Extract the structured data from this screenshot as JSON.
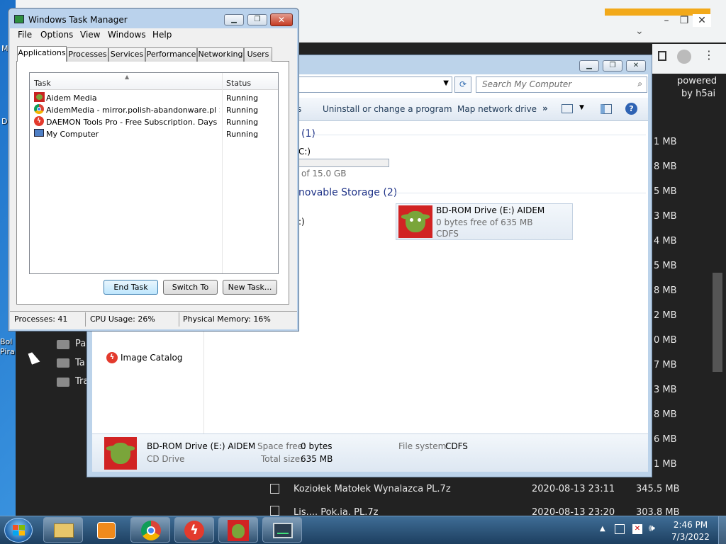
{
  "desktop": {
    "shortcut_a": "M",
    "shortcut_b": "D",
    "shortcut_c": "Bol",
    "shortcut_d": "Pira"
  },
  "chrome": {
    "powered": "powered",
    "by": "by h5ai",
    "folders": [
      "Pa",
      "Ta",
      "Tra"
    ],
    "sizes": [
      "1 MB",
      "8 MB",
      "5 MB",
      "3 MB",
      "4 MB",
      "5 MB",
      "8 MB",
      "2 MB",
      "0 MB",
      "7 MB",
      "3 MB",
      "8 MB",
      "6 MB",
      "1 MB"
    ],
    "file_name": "Koziołek Matołek Wynalazca PL.7z",
    "file_date": "2020-08-13 23:11",
    "file_size": "345.5 MB",
    "cut_file_name": "Lis.... Pok.ia. PL.7z",
    "cut_file_date": "2020-08-13 23:20",
    "cut_file_size": "303.8 MB"
  },
  "explorer": {
    "search_placeholder": "Search My Computer",
    "cmd_partial": "s",
    "cmd_uninstall": "Uninstall or change a program",
    "cmd_map": "Map network drive",
    "cmd_more": "»",
    "hdd_count": "(1)",
    "hdd_label": "C:)",
    "hdd_free": "of 15.0 GB",
    "removable_header": "novable Storage (2)",
    "floppy_label": ":)",
    "drive_name": "BD-ROM Drive (E:) AIDEM",
    "drive_free": "0 bytes free of 635 MB",
    "drive_fs": "CDFS",
    "nav_image_catalog": "Image Catalog",
    "details": {
      "name": "BD-ROM Drive (E:) AIDEM",
      "type": "CD Drive",
      "space_free_label": "Space free:",
      "space_free": "0 bytes",
      "total_size_label": "Total size:",
      "total_size": "635 MB",
      "fs_label": "File system:",
      "fs": "CDFS"
    }
  },
  "taskmanager": {
    "title": "Windows Task Manager",
    "menu": [
      "File",
      "Options",
      "View",
      "Windows",
      "Help"
    ],
    "tabs": [
      "Applications",
      "Processes",
      "Services",
      "Performance",
      "Networking",
      "Users"
    ],
    "col_task": "Task",
    "col_status": "Status",
    "rows": [
      {
        "task": "Aidem Media",
        "status": "Running",
        "icon": "aidem-icon"
      },
      {
        "task": "AidemMedia - mirror.polish-abandonware.pl > Gr...",
        "status": "Running",
        "icon": "chrome-icon"
      },
      {
        "task": "DAEMON Tools Pro - Free Subscription. Days left...",
        "status": "Running",
        "icon": "daemon-tools-icon"
      },
      {
        "task": "My Computer",
        "status": "Running",
        "icon": "computer-icon"
      }
    ],
    "btn_end": "End Task",
    "btn_switch": "Switch To",
    "btn_new": "New Task...",
    "processes": "Processes: 41",
    "cpu": "CPU Usage: 26%",
    "memory": "Physical Memory: 16%"
  },
  "taskbar": {
    "time": "2:46 PM",
    "date": "7/3/2022",
    "pins": [
      "explorer-icon",
      "media-player-icon",
      "chrome-icon",
      "daemon-tools-icon",
      "aidem-icon",
      "task-manager-icon"
    ]
  },
  "colors": {
    "accent": "#1e3287",
    "tm_frame": "#bad2ec",
    "taskbar": "#1d3f60"
  }
}
